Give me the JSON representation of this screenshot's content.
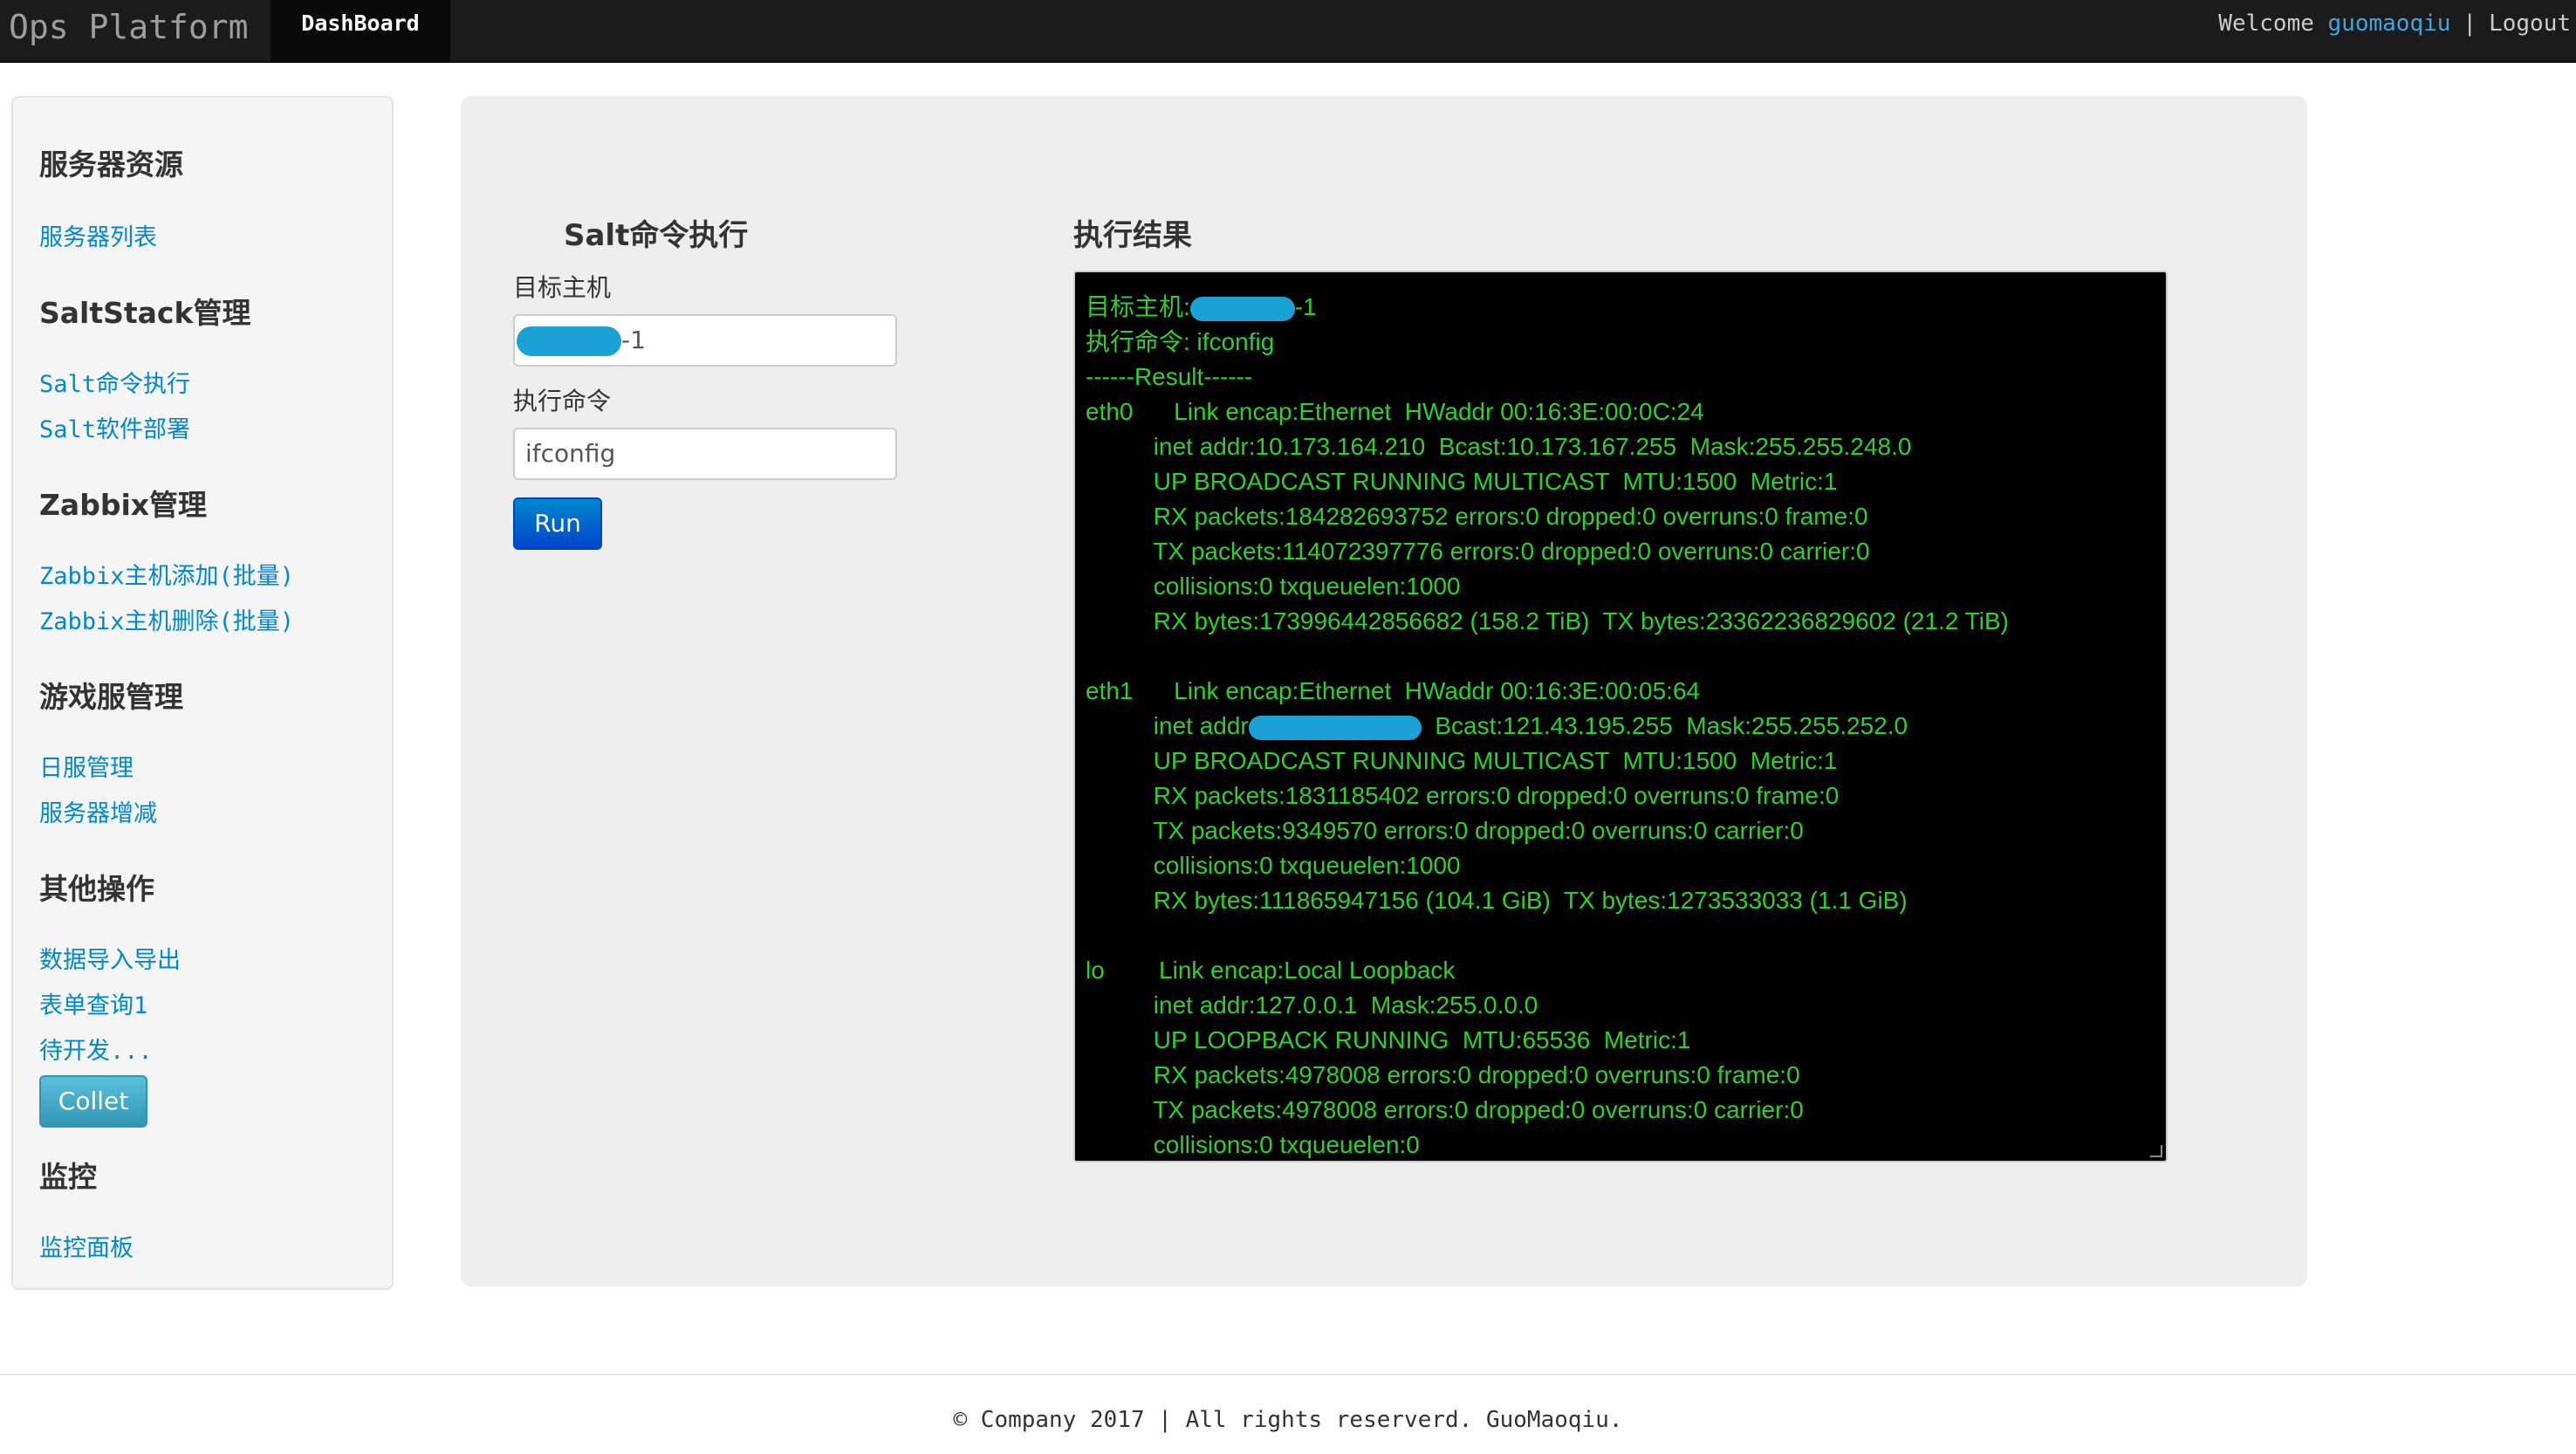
{
  "navbar": {
    "brand": "Ops Platform",
    "active_tab": "DashBoard",
    "welcome": "Welcome",
    "user": "guomaoqiu",
    "separator": "|",
    "logout": "Logout"
  },
  "sidebar": {
    "sections": [
      {
        "heading": "服务器资源",
        "links": [
          "服务器列表"
        ]
      },
      {
        "heading": "SaltStack管理",
        "links": [
          "Salt命令执行",
          "Salt软件部署"
        ]
      },
      {
        "heading": "Zabbix管理",
        "links": [
          "Zabbix主机添加(批量)",
          "Zabbix主机删除(批量)"
        ]
      },
      {
        "heading": "游戏服管理",
        "links": [
          "日服管理",
          "服务器增减"
        ]
      },
      {
        "heading": "其他操作",
        "links": [
          "数据导入导出",
          "表单查询1",
          "待开发..."
        ]
      },
      {
        "heading": "监控",
        "links": [
          "监控面板"
        ]
      }
    ],
    "collet_button": "Collet"
  },
  "form": {
    "title": "Salt命令执行",
    "target_label": "目标主机",
    "target_value_suffix": "-1",
    "command_label": "执行命令",
    "command_value": "ifconfig",
    "run_button": "Run"
  },
  "result": {
    "title": "执行结果",
    "header_target_prefix": "目标主机:",
    "header_target_suffix": "-1",
    "lines": [
      "执行命令: ifconfig",
      "------Result------",
      "eth0      Link encap:Ethernet  HWaddr 00:16:3E:00:0C:24",
      "          inet addr:10.173.164.210  Bcast:10.173.167.255  Mask:255.255.248.0",
      "          UP BROADCAST RUNNING MULTICAST  MTU:1500  Metric:1",
      "          RX packets:184282693752 errors:0 dropped:0 overruns:0 frame:0",
      "          TX packets:114072397776 errors:0 dropped:0 overruns:0 carrier:0",
      "          collisions:0 txqueuelen:1000",
      "          RX bytes:173996442856682 (158.2 TiB)  TX bytes:23362236829602 (21.2 TiB)",
      "",
      "eth1      Link encap:Ethernet  HWaddr 00:16:3E:00:05:64"
    ],
    "eth1_inet_prefix": "          inet addr",
    "eth1_inet_suffix": "  Bcast:121.43.195.255  Mask:255.255.252.0",
    "lines2": [
      "          UP BROADCAST RUNNING MULTICAST  MTU:1500  Metric:1",
      "          RX packets:1831185402 errors:0 dropped:0 overruns:0 frame:0",
      "          TX packets:9349570 errors:0 dropped:0 overruns:0 carrier:0",
      "          collisions:0 txqueuelen:1000",
      "          RX bytes:111865947156 (104.1 GiB)  TX bytes:1273533033 (1.1 GiB)",
      "",
      "lo        Link encap:Local Loopback",
      "          inet addr:127.0.0.1  Mask:255.0.0.0",
      "          UP LOOPBACK RUNNING  MTU:65536  Metric:1",
      "          RX packets:4978008 errors:0 dropped:0 overruns:0 frame:0",
      "          TX packets:4978008 errors:0 dropped:0 overruns:0 carrier:0",
      "          collisions:0 txqueuelen:0"
    ]
  },
  "footer": {
    "text": "© Company 2017 | All rights reserverd. GuoMaoqiu."
  }
}
